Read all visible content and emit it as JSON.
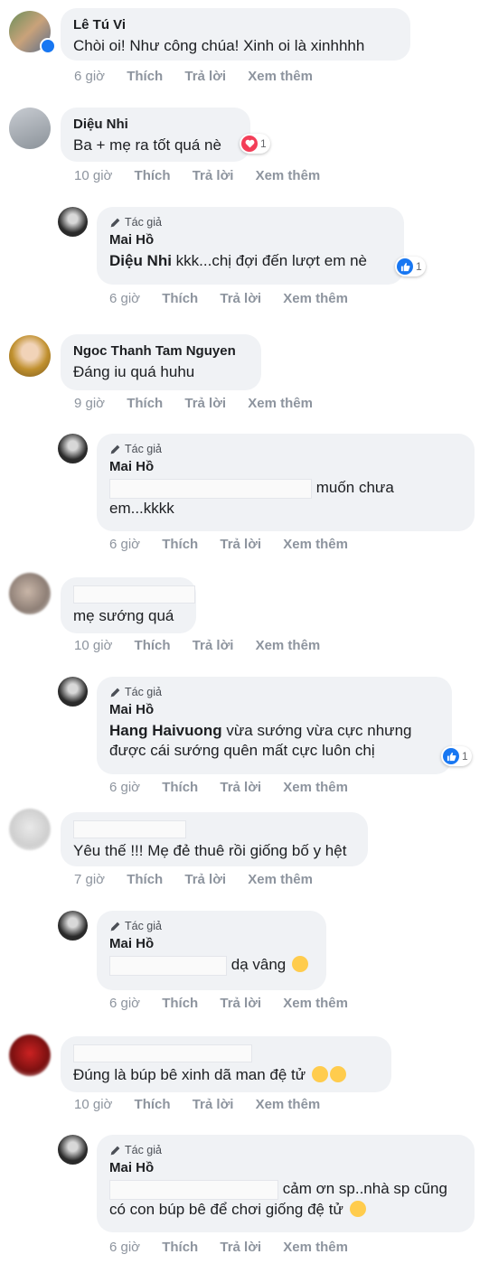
{
  "labels": {
    "author": "Tác giả",
    "like": "Thích",
    "reply": "Trả lời",
    "more": "Xem thêm"
  },
  "comments": [
    {
      "name": "Lê Tú Vi",
      "text": "Chòi oi! Như công chúa! Xinh oi là xinhhhh",
      "time": "6 giờ"
    },
    {
      "name": "Diệu Nhi",
      "text": "Ba + mẹ ra tốt quá nè",
      "time": "10 giờ",
      "reaction_count": "1",
      "reaction": "heart-icon"
    },
    {
      "reply": true,
      "name": "Mai Hồ",
      "mention": "Diệu Nhi",
      "text": " kkk...chị đợi đến lượt em nè",
      "time": "6 giờ",
      "reaction_count": "1",
      "reaction": "like-icon"
    },
    {
      "name": "Ngoc Thanh Tam Nguyen",
      "text": "Đáng iu quá huhu",
      "time": "9 giờ"
    },
    {
      "reply": true,
      "name": "Mai Hồ",
      "text_a": "muốn chưa",
      "text_b": "em...kkkk",
      "time": "6 giờ"
    },
    {
      "text": "mẹ sướng quá",
      "time": "10 giờ"
    },
    {
      "reply": true,
      "name": "Mai Hồ",
      "mention": "Hang Haivuong",
      "text_a": " vừa sướng vừa cực nhưng",
      "text_b": "được cái sướng quên mất cực luôn chị",
      "time": "6 giờ",
      "reaction_count": "1",
      "reaction": "like-icon"
    },
    {
      "text": "Yêu thế !!! Mẹ đẻ thuê rồi giống bố y hệt",
      "time": "7 giờ"
    },
    {
      "reply": true,
      "name": "Mai Hồ",
      "text": "dạ vâng",
      "time": "6 giờ"
    },
    {
      "text": "Đúng là búp bê xinh dã man đệ tử",
      "time": "10 giờ"
    },
    {
      "reply": true,
      "name": "Mai Hồ",
      "text_a": "cảm ơn sp..nhà sp cũng",
      "text_b": "có con búp bê để chơi giống đệ tử",
      "time": "6 giờ"
    }
  ]
}
